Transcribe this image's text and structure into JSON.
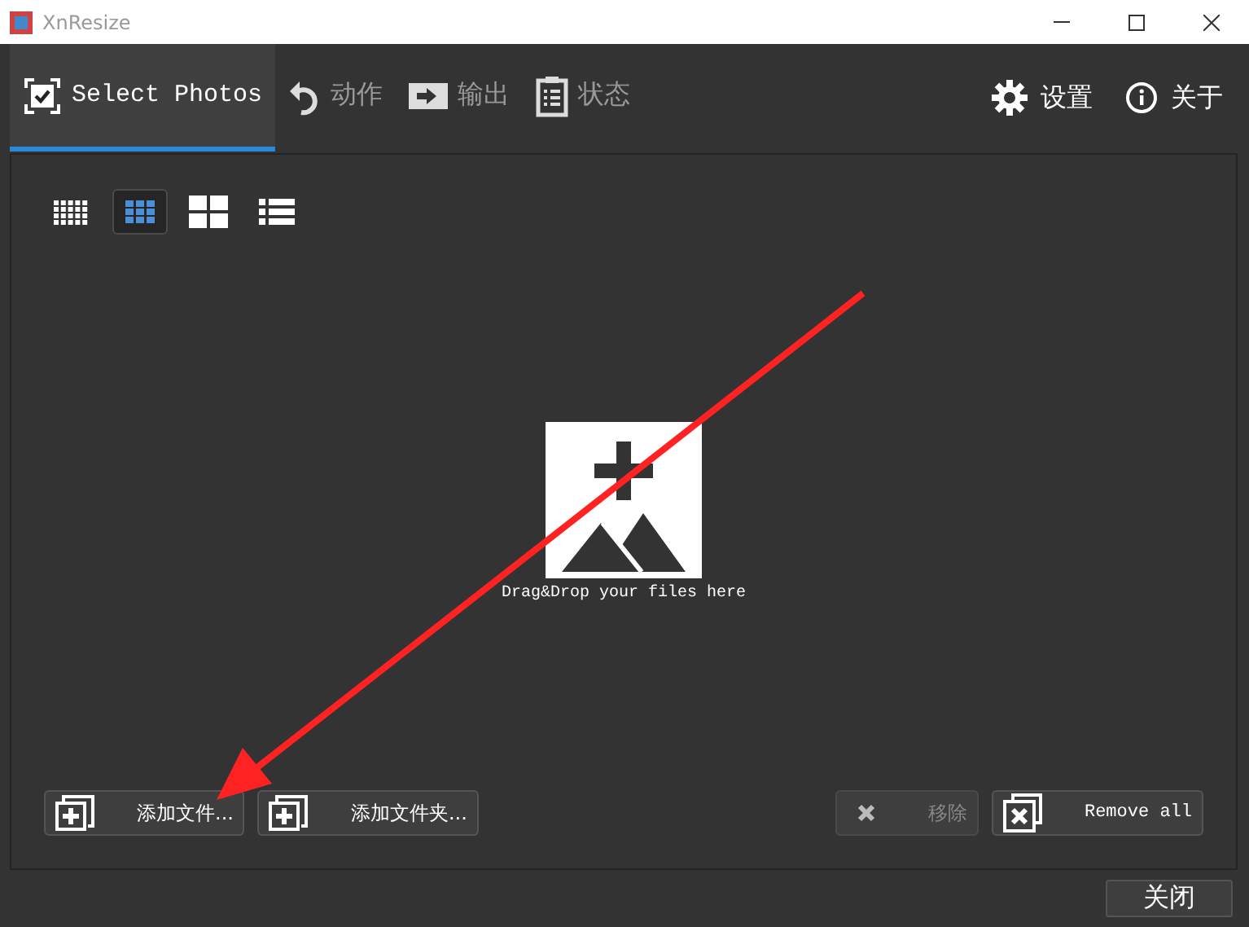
{
  "window": {
    "title": "XnResize"
  },
  "tabs": [
    {
      "label": "Select Photos",
      "selected": true
    },
    {
      "label": "动作",
      "selected": false
    },
    {
      "label": "输出",
      "selected": false
    },
    {
      "label": "状态",
      "selected": false
    }
  ],
  "top_links": [
    {
      "label": "设置"
    },
    {
      "label": "关于"
    }
  ],
  "view_modes": [
    {
      "selected": false
    },
    {
      "selected": true
    },
    {
      "selected": false
    },
    {
      "selected": false
    }
  ],
  "drop_hint": "Drag&Drop your files here",
  "left_buttons": [
    {
      "label": "添加文件...",
      "disabled": false
    },
    {
      "label": "添加文件夹...",
      "disabled": false
    }
  ],
  "right_buttons": [
    {
      "label": "移除",
      "disabled": true
    },
    {
      "label": "Remove all",
      "disabled": false
    }
  ],
  "close_button": {
    "label": "关闭"
  }
}
